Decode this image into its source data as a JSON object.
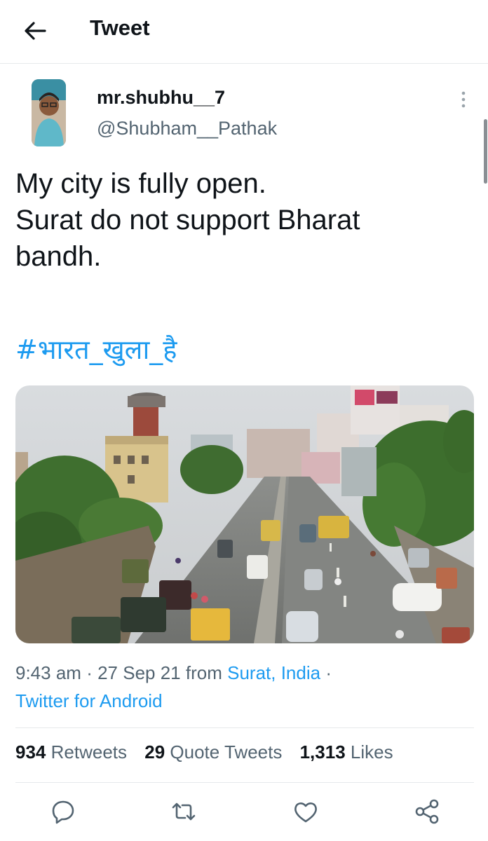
{
  "header": {
    "title": "Tweet",
    "back_icon": "arrow-left-icon"
  },
  "tweet": {
    "display_name": "mr.shubhu__7",
    "handle": "@Shubham__Pathak",
    "text_lines": [
      "My city is fully open.",
      "Surat do not support Bharat",
      "bandh."
    ],
    "hashtag": "#भारत_खुला_है",
    "time": "9:43 am",
    "date": "27 Sep 21",
    "from_label": "from",
    "location": "Surat, India",
    "source": "Twitter for Android",
    "media": {
      "description_icon": "street-photo"
    }
  },
  "stats": {
    "retweets_count": "934",
    "retweets_label": "Retweets",
    "quotes_count": "29",
    "quotes_label": "Quote Tweets",
    "likes_count": "1,313",
    "likes_label": "Likes"
  },
  "colors": {
    "accent": "#1d9bf0",
    "secondary_text": "#536471",
    "divider": "#e6e9eb"
  },
  "actions": [
    "reply-icon",
    "retweet-icon",
    "like-icon",
    "share-icon"
  ]
}
